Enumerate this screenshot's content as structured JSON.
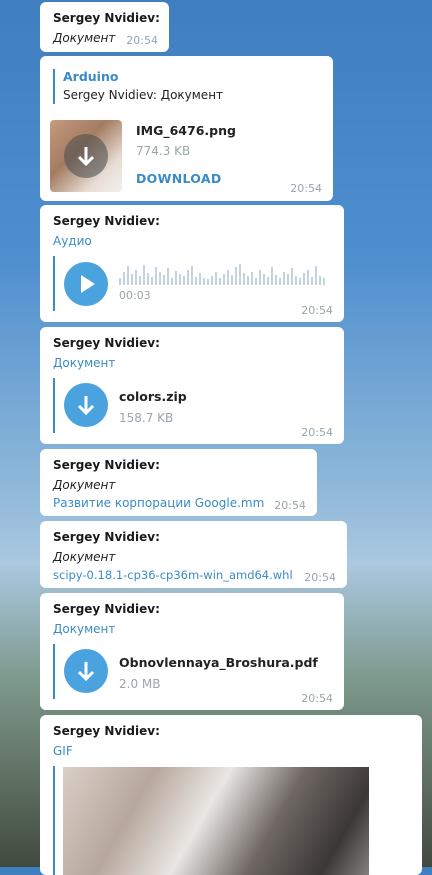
{
  "messages": [
    {
      "sender": "Sergey Nvidiev:",
      "type_label": "Документ",
      "time": "20:54"
    },
    {
      "reply_title": "Arduino",
      "reply_text": "Sergey Nvidiev: Документ",
      "file_name": "IMG_6476.png",
      "file_size": "774.3 KB",
      "action": "DOWNLOAD",
      "time": "20:54"
    },
    {
      "sender": "Sergey Nvidiev:",
      "type_label": "Аудио",
      "duration": "00:03",
      "time": "20:54"
    },
    {
      "sender": "Sergey Nvidiev:",
      "type_label": "Документ",
      "file_name": "colors.zip",
      "file_size": "158.7 KB",
      "time": "20:54"
    },
    {
      "sender": "Sergey Nvidiev:",
      "type_label": "Документ",
      "file_link": "Развитие корпорации Google.mm",
      "time": "20:54"
    },
    {
      "sender": "Sergey Nvidiev:",
      "type_label": "Документ",
      "file_link": "scipy-0.18.1-cp36-cp36m-win_amd64.whl",
      "time": "20:54"
    },
    {
      "sender": "Sergey Nvidiev:",
      "type_label": "Документ",
      "file_name": "Obnovlennaya_Broshura.pdf",
      "file_size": "2.0 MB",
      "time": "20:54"
    },
    {
      "sender": "Sergey Nvidiev:",
      "type_label": "GIF"
    }
  ],
  "icons": {
    "download": "download-arrow-icon",
    "play": "play-icon"
  },
  "colors": {
    "accent": "#3a8bc8",
    "button": "#4aa3df",
    "meta": "#9aa5ad"
  },
  "waveform_levels": [
    0.3,
    0.6,
    0.85,
    0.5,
    0.7,
    0.4,
    0.9,
    0.55,
    0.35,
    0.8,
    0.6,
    0.45,
    0.75,
    0.3,
    0.65,
    0.5,
    0.4,
    0.7,
    0.85,
    0.35,
    0.55,
    0.3,
    0.25,
    0.4,
    0.6,
    0.3,
    0.5,
    0.7,
    0.45,
    0.8,
    0.95,
    0.55,
    0.4,
    0.6,
    0.3,
    0.7,
    0.5,
    0.35,
    0.8,
    0.45,
    0.3,
    0.6,
    0.5,
    0.75,
    0.4,
    0.3,
    0.55,
    0.7,
    0.35,
    0.85,
    0.4,
    0.3,
    0.6,
    0.45,
    0.3,
    0.5,
    0.8,
    0.35,
    0.3,
    0.6,
    0.75,
    0.4,
    0.55,
    0.3,
    0.35,
    0.5,
    0.65,
    0.3,
    0.4,
    0.3
  ]
}
